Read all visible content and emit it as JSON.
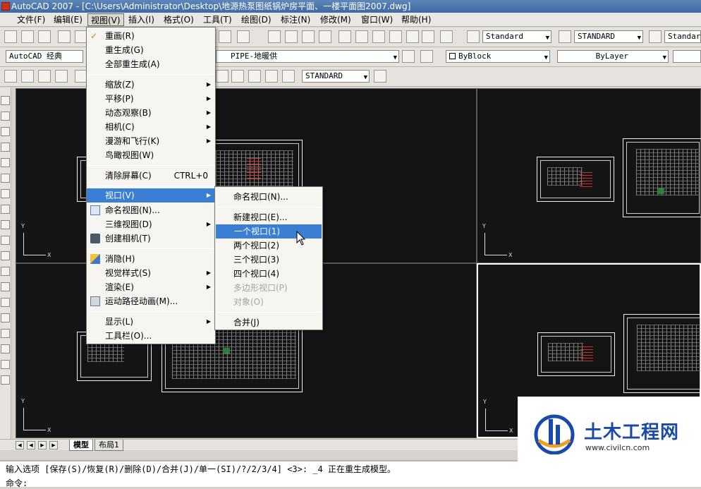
{
  "window": {
    "title": "AutoCAD 2007 - [C:\\Users\\Administrator\\Desktop\\地源热泵图纸锅炉房平面、一楼平面图2007.dwg]"
  },
  "menubar": [
    {
      "label": "文件(F)"
    },
    {
      "label": "编辑(E)"
    },
    {
      "label": "视图(V)"
    },
    {
      "label": "插入(I)"
    },
    {
      "label": "格式(O)"
    },
    {
      "label": "工具(T)"
    },
    {
      "label": "绘图(D)"
    },
    {
      "label": "标注(N)"
    },
    {
      "label": "修改(M)"
    },
    {
      "label": "窗口(W)"
    },
    {
      "label": "帮助(H)"
    }
  ],
  "toolbar": {
    "text_style": "Standard",
    "dim_style": "STANDARD",
    "table_style": "Standard",
    "workspace": "AutoCAD 经典",
    "layer": "PIPE-地暖供",
    "color": "ByBlock",
    "linetype": "ByLayer",
    "dim_style2": "STANDARD"
  },
  "view_menu": {
    "items": [
      {
        "label": "重画(R)",
        "icon": "redraw-icon"
      },
      {
        "label": "重生成(G)"
      },
      {
        "label": "全部重生成(A)"
      },
      {
        "label": "缩放(Z)",
        "submenu": true
      },
      {
        "label": "平移(P)",
        "submenu": true
      },
      {
        "label": "动态观察(B)",
        "submenu": true
      },
      {
        "label": "相机(C)",
        "submenu": true
      },
      {
        "label": "漫游和飞行(K)",
        "submenu": true
      },
      {
        "label": "鸟瞰视图(W)"
      },
      {
        "label": "清除屏幕(C)",
        "shortcut": "CTRL+0"
      },
      {
        "label": "视口(V)",
        "submenu": true,
        "highlighted": true
      },
      {
        "label": "命名视图(N)...",
        "icon": "named-view-icon"
      },
      {
        "label": "三维视图(D)",
        "submenu": true
      },
      {
        "label": "创建相机(T)",
        "icon": "camera-icon"
      },
      {
        "label": "消隐(H)",
        "icon": "hide-icon"
      },
      {
        "label": "视觉样式(S)",
        "submenu": true
      },
      {
        "label": "渲染(E)",
        "submenu": true
      },
      {
        "label": "运动路径动画(M)...",
        "icon": "motion-path-icon"
      },
      {
        "label": "显示(L)",
        "submenu": true
      },
      {
        "label": "工具栏(O)..."
      }
    ]
  },
  "viewport_menu": {
    "items": [
      {
        "label": "命名视口(N)..."
      },
      {
        "label": "新建视口(E)..."
      },
      {
        "label": "一个视口(1)",
        "highlighted": true
      },
      {
        "label": "两个视口(2)"
      },
      {
        "label": "三个视口(3)"
      },
      {
        "label": "四个视口(4)"
      },
      {
        "label": "多边形视口(P)",
        "disabled": true
      },
      {
        "label": "对象(O)",
        "disabled": true
      },
      {
        "label": "合并(J)"
      }
    ]
  },
  "layout_tabs": [
    {
      "label": "模型"
    },
    {
      "label": "布局1"
    }
  ],
  "command": {
    "line1": "输入选项 [保存(S)/恢复(R)/删除(D)/合并(J)/单一(SI)/?/2/3/4] <3>: _4 正在重生成模型。",
    "line2": "命令:"
  },
  "ucs": {
    "x": "X",
    "y": "Y"
  },
  "watermark": {
    "title": "土木工程网",
    "url": "www.civilcn.com"
  }
}
